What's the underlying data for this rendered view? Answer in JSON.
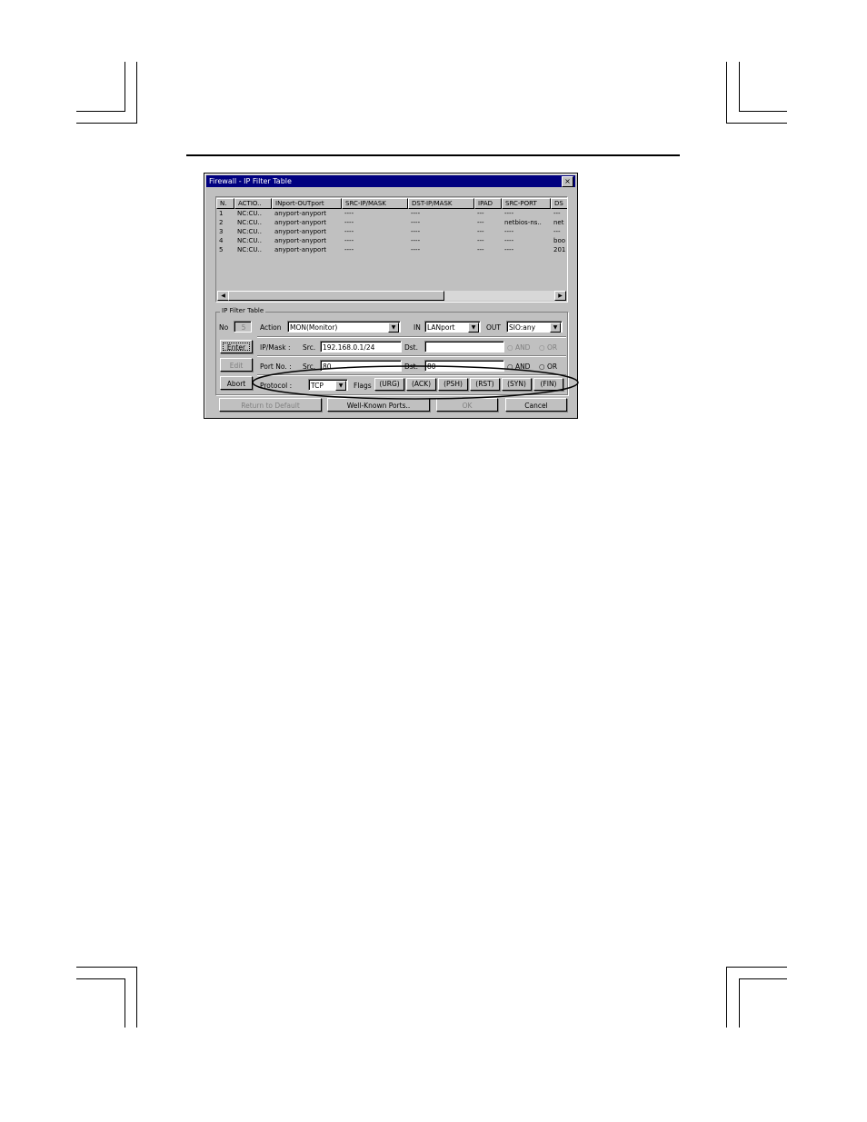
{
  "dialog": {
    "title": "Firewall - IP Filter Table",
    "close": "×",
    "columns": [
      "N.",
      "ACTIO..",
      "INport-OUTport",
      "SRC-IP/MASK",
      "DST-IP/MASK",
      "IPAD",
      "SRC-PORT",
      "DS"
    ],
    "rows": [
      [
        "1",
        "NC:CU..",
        "anyport-anyport",
        "----",
        "----",
        "---",
        "----",
        "---"
      ],
      [
        "2",
        "NC:CU..",
        "anyport-anyport",
        "----",
        "----",
        "---",
        "netbios-ns..",
        "net"
      ],
      [
        "3",
        "NC:CU..",
        "anyport-anyport",
        "----",
        "----",
        "---",
        "----",
        "---"
      ],
      [
        "4",
        "NC:CU..",
        "anyport-anyport",
        "----",
        "----",
        "---",
        "----",
        "boo"
      ],
      [
        "5",
        "NC:CU..",
        "anyport-anyport",
        "----",
        "----",
        "---",
        "----",
        "201"
      ]
    ],
    "group_label": "IP Filter Table",
    "no_label": "No",
    "no_value": "5",
    "action_label": "Action",
    "action_value": "MON(Monitor)",
    "in_label": "IN",
    "in_value": "LANport",
    "out_label": "OUT",
    "out_value": "SIO:any",
    "ipmask_label": "IP/Mask :",
    "src_label": "Src.",
    "dst_label": "Dst.",
    "ip_src": "192.168.0.1/24",
    "ip_dst": "",
    "port_label": "Port No. :",
    "port_src": "80",
    "port_dst": "80",
    "and_label": "AND",
    "or_label": "OR",
    "protocol_label": "Protocol :",
    "protocol_value": "TCP",
    "flags_label": "Flags",
    "flags": [
      "(URG)",
      "(ACK)",
      "(PSH)",
      "(RST)",
      "(SYN)",
      "(FIN)"
    ],
    "enter": "Enter",
    "edit": "Edit",
    "abort": "Abort",
    "return_default": "Return to Default",
    "well_known": "Well-Known Ports..",
    "ok": "OK",
    "cancel": "Cancel"
  }
}
